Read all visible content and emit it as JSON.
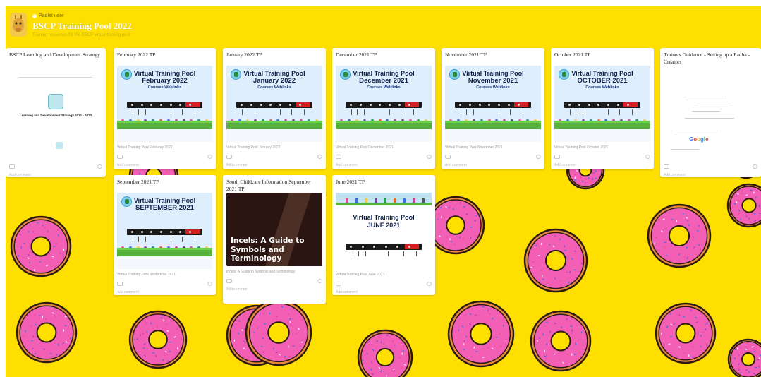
{
  "board": {
    "author": "Padlet user",
    "title": "BSCP Training Pool 2022",
    "description": "Training resources for the BSCP virtual training pool",
    "background_color": "#fedf00"
  },
  "columns": [
    {
      "title": "BSCP Learning and Development Strategy",
      "thumb_kind": "strategy",
      "thumb_title": "Learning and Development Strategy 2021 - 2023",
      "meta": "",
      "add_comment": "Add comment"
    },
    {
      "title": "February 2022 TP",
      "thumb_kind": "pool",
      "line1": "Virtual Training Pool",
      "line2": "February 2022",
      "line3": "Courses Weblinks",
      "meta": "Virtual Training Pool February 2022",
      "add_comment": "Add comment"
    },
    {
      "title": "January 2022 TP",
      "thumb_kind": "pool",
      "line1": "Virtual Training Pool",
      "line2": "January 2022",
      "line3": "Courses Weblinks",
      "meta": "Virtual Training Pool January 2022",
      "add_comment": "Add comment"
    },
    {
      "title": "December 2021 TP",
      "thumb_kind": "pool",
      "line1": "Virtual Training Pool",
      "line2": "December 2021",
      "line3": "Courses Weblinks",
      "meta": "Virtual Training Pool December 2021",
      "add_comment": "Add comment"
    },
    {
      "title": "November 2021 TP",
      "thumb_kind": "pool",
      "line1": "Virtual Training Pool",
      "line2": "November 2021",
      "line3": "Courses Weblinks",
      "meta": "Virtual Training Pool November 2021",
      "add_comment": "Add comment"
    },
    {
      "title": "October 2021 TP",
      "thumb_kind": "pool",
      "line1": "Virtual Training Pool",
      "line2": "OCTOBER 2021",
      "line3": "Courses Weblinks",
      "meta": "Virtual Training Pool October 2021",
      "add_comment": "Add comment"
    },
    {
      "title": "Trainers Guidance - Setting up a Padlet - Creators",
      "thumb_kind": "tech",
      "meta": "",
      "add_comment": "Add comment"
    },
    {
      "title": "September 2021 TP",
      "thumb_kind": "pool",
      "line1": "Virtual Training Pool",
      "line2": "SEPTEMBER 2021",
      "line3": "",
      "meta": "Virtual Training Pool September 2021",
      "add_comment": "Add comment"
    },
    {
      "title": "South Childcare Information September 2021 TP",
      "thumb_kind": "dark",
      "dark_text": "Incels: A Guide to Symbols and Terminology",
      "meta": "Incels: A Guide to Symbols and Terminology",
      "add_comment": "Add comment"
    },
    {
      "title": "June 2021 TP",
      "thumb_kind": "june",
      "line1": "Virtual Training Pool",
      "line2": "JUNE 2021",
      "meta": "Virtual Training Pool June 2021",
      "add_comment": "Add comment"
    }
  ],
  "icons": {
    "avatar": "giraffe-avatar-icon",
    "like": "heart-icon",
    "comment": "comment-icon",
    "logo": "training-pool-logo-icon",
    "background_item": "donut-icon"
  }
}
